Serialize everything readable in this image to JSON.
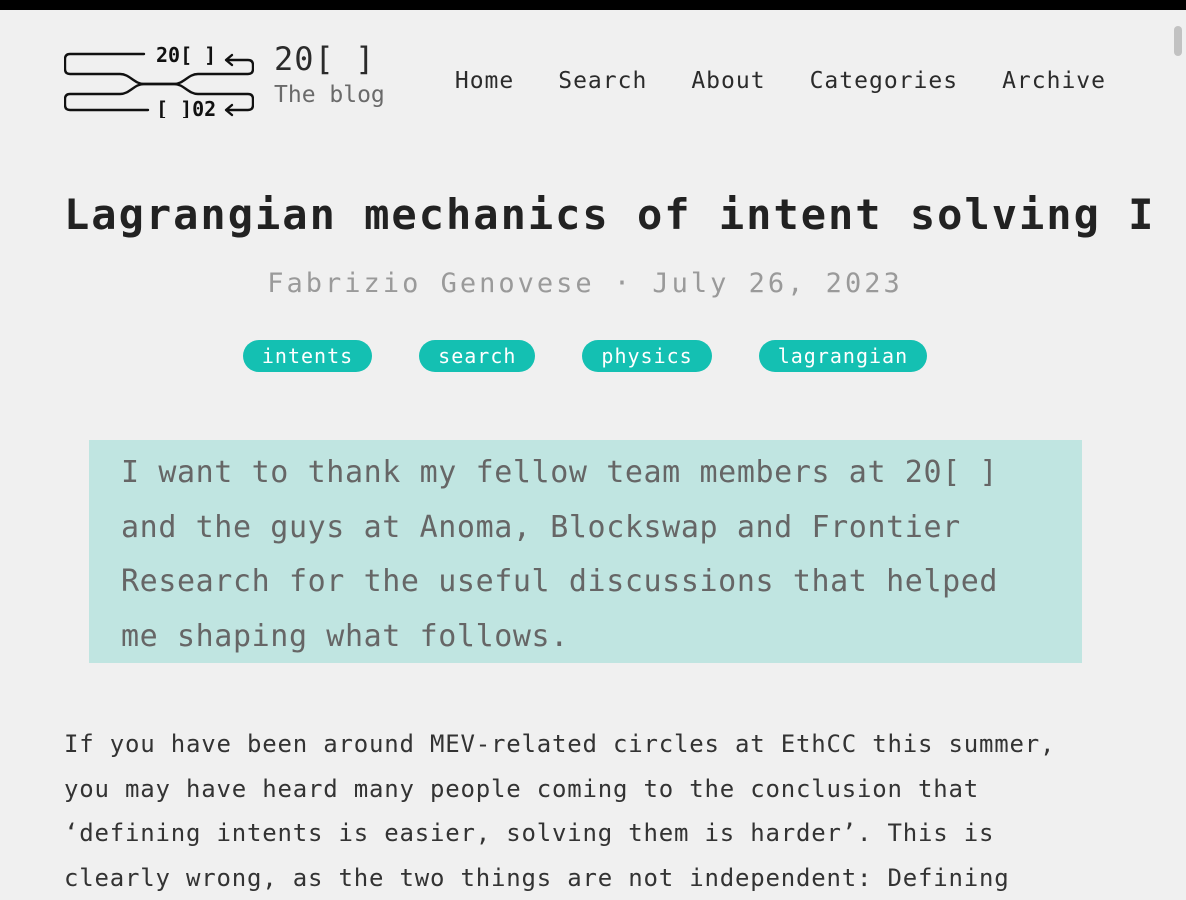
{
  "site": {
    "logo_top": "20[ ]",
    "logo_bottom": "[ ]02",
    "title": "20[ ]",
    "subtitle": "The blog"
  },
  "nav": {
    "items": [
      {
        "label": "Home"
      },
      {
        "label": "Search"
      },
      {
        "label": "About"
      },
      {
        "label": "Categories"
      },
      {
        "label": "Archive"
      }
    ]
  },
  "post": {
    "title": "Lagrangian mechanics of intent solving I",
    "meta": "Fabrizio Genovese · July 26, 2023",
    "tags": [
      "intents",
      "search",
      "physics",
      "lagrangian"
    ],
    "callout": "I want to thank my fellow team members at 20[ ] and the guys at Anoma, Blockswap and Frontier Research for the useful discussions that helped me shaping what follows.",
    "body": "If you have been around MEV-related circles at EthCC this summer, you may have heard many people coming to the conclusion that ‘defining intents is easier, solving them is harder’. This is clearly wrong, as the two things are not independent: Defining"
  },
  "colors": {
    "background": "#f0f0f0",
    "tag": "#14c0b2",
    "callout": "#c0e5e1",
    "topbar": "#000000"
  }
}
